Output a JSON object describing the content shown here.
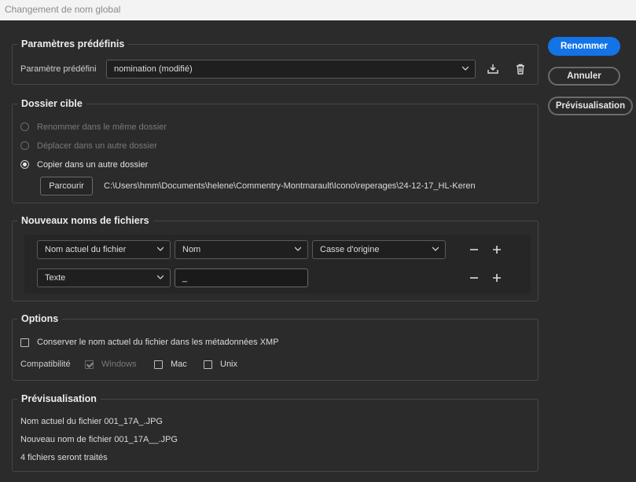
{
  "window": {
    "title": "Changement de nom global"
  },
  "buttons": {
    "rename": "Renommer",
    "cancel": "Annuler",
    "preview": "Prévisualisation"
  },
  "presets": {
    "legend": "Paramètres prédéfinis",
    "label": "Paramètre prédéfini",
    "value": "nomination (modifié)",
    "save_icon": "save-preset-icon",
    "delete_icon": "trash-icon"
  },
  "destination": {
    "legend": "Dossier cible",
    "options": [
      {
        "label": "Renommer dans le même dossier",
        "selected": false,
        "enabled": false
      },
      {
        "label": "Déplacer dans un autre dossier",
        "selected": false,
        "enabled": false
      },
      {
        "label": "Copier dans un autre dossier",
        "selected": true,
        "enabled": true
      }
    ],
    "browse_label": "Parcourir",
    "path": "C:\\Users\\hmm\\Documents\\helene\\Commentry-Montmarault\\Icono\\reperages\\24-12-17_HL-Keren"
  },
  "new_names": {
    "legend": "Nouveaux noms de fichiers",
    "rows": [
      {
        "type": "Nom actuel du fichier",
        "option": "Nom",
        "case": "Casse d'origine"
      },
      {
        "type": "Texte",
        "text": "_"
      }
    ]
  },
  "options": {
    "legend": "Options",
    "keep_name_label": "Conserver le nom actuel du fichier dans les métadonnées XMP",
    "keep_name_checked": false,
    "compat_label": "Compatibilité",
    "compat": [
      {
        "label": "Windows",
        "checked": true,
        "enabled": false
      },
      {
        "label": "Mac",
        "checked": false,
        "enabled": true
      },
      {
        "label": "Unix",
        "checked": false,
        "enabled": true
      }
    ]
  },
  "preview": {
    "legend": "Prévisualisation",
    "current_name": "Nom actuel du fichier 001_17A_.JPG",
    "new_name": "Nouveau nom de fichier 001_17A__.JPG",
    "count": "4 fichiers seront traités"
  }
}
